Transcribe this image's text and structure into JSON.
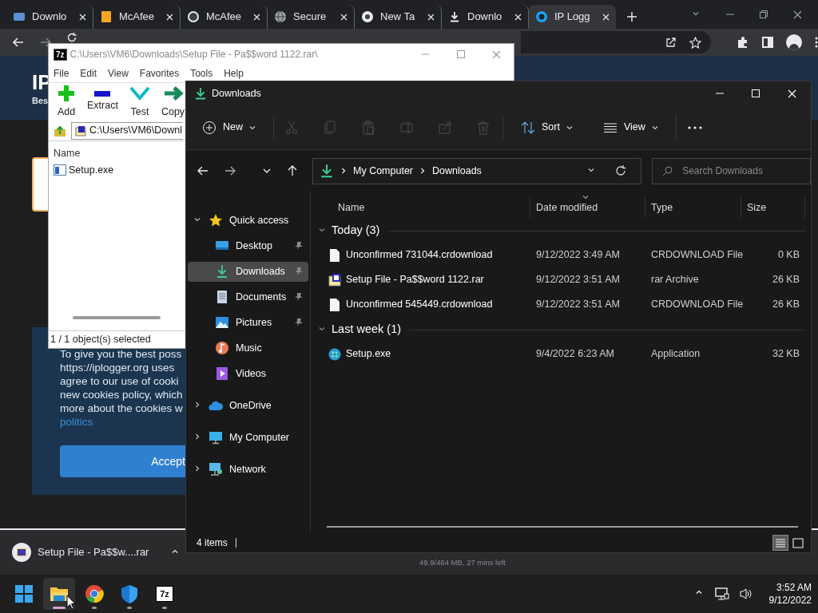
{
  "browser": {
    "tabs": [
      {
        "title": "Downlo",
        "selected": false
      },
      {
        "title": "McAfee",
        "selected": false
      },
      {
        "title": "McAfee",
        "selected": false
      },
      {
        "title": "Secure",
        "selected": false
      },
      {
        "title": "New Ta",
        "selected": false
      },
      {
        "title": "Downlo",
        "selected": false
      },
      {
        "title": "IP Logg",
        "selected": true
      }
    ],
    "page": {
      "header_title": "IP",
      "header_subtitle": "Bes",
      "cookie_lines": [
        "To give you the best poss",
        "https://iplogger.org uses",
        "agree to our use of cooki",
        "new cookies policy, which",
        "more about the cookies w"
      ],
      "cookie_link": "politics",
      "accept_button": "Accept"
    },
    "download_shelf": {
      "items": [
        {
          "name": "Setup File - Pa$$w....rar"
        }
      ],
      "hidden_progress": "49.9/464 MB, 27 mins left"
    }
  },
  "sevenzip": {
    "logo": "7z",
    "title": "C:\\Users\\VM6\\Downloads\\Setup File - Pa$$word 1122.rar\\",
    "menu": [
      "File",
      "Edit",
      "View",
      "Favorites",
      "Tools",
      "Help"
    ],
    "toolbar": [
      "Add",
      "Extract",
      "Test",
      "Copy"
    ],
    "path": "C:\\Users\\VM6\\Downl",
    "column": "Name",
    "files": [
      "Setup.exe"
    ],
    "status": "1 / 1 object(s) selected"
  },
  "explorer": {
    "title": "Downloads",
    "commands": [
      "New",
      "Sort",
      "View"
    ],
    "breadcrumb": [
      "My Computer",
      "Downloads"
    ],
    "search_placeholder": "Search Downloads",
    "nav": [
      {
        "label": "Quick access",
        "expanded": true,
        "selected": false,
        "children": [
          {
            "label": "Desktop",
            "pinned": true,
            "selected": false
          },
          {
            "label": "Downloads",
            "pinned": true,
            "selected": true
          },
          {
            "label": "Documents",
            "pinned": true,
            "selected": false
          },
          {
            "label": "Pictures",
            "pinned": true,
            "selected": false
          },
          {
            "label": "Music",
            "pinned": false,
            "selected": false
          },
          {
            "label": "Videos",
            "pinned": false,
            "selected": false
          }
        ]
      },
      {
        "label": "OneDrive",
        "expanded": false,
        "selected": false
      },
      {
        "label": "My Computer",
        "expanded": false,
        "selected": false
      },
      {
        "label": "Network",
        "expanded": false,
        "selected": false
      }
    ],
    "columns": [
      {
        "label": "Name",
        "sorted": false
      },
      {
        "label": "Date modified",
        "sorted": true
      },
      {
        "label": "Type",
        "sorted": false
      },
      {
        "label": "Size",
        "sorted": false
      }
    ],
    "groups": [
      {
        "label": "Today (3)",
        "expanded": true,
        "files": [
          {
            "kind": "blank",
            "name": "Unconfirmed 731044.crdownload",
            "date": "9/12/2022 3:49 AM",
            "type": "CRDOWNLOAD File",
            "size": "0 KB"
          },
          {
            "kind": "rar",
            "name": "Setup File - Pa$$word 1122.rar",
            "date": "9/12/2022 3:51 AM",
            "type": "rar Archive",
            "size": "26 KB"
          },
          {
            "kind": "blank",
            "name": "Unconfirmed 545449.crdownload",
            "date": "9/12/2022 3:51 AM",
            "type": "CRDOWNLOAD File",
            "size": "26 KB"
          }
        ]
      },
      {
        "label": "Last week (1)",
        "expanded": true,
        "files": [
          {
            "kind": "exe",
            "name": "Setup.exe",
            "date": "9/4/2022 6:23 AM",
            "type": "Application",
            "size": "32 KB"
          }
        ]
      }
    ],
    "status": "4 items",
    "view_modes": [
      {
        "selected": true
      },
      {
        "selected": false
      }
    ]
  },
  "taskbar": {
    "apps": [
      {
        "kind": "start",
        "selected": false
      },
      {
        "kind": "explorer",
        "selected": true
      },
      {
        "kind": "chrome",
        "selected": false
      },
      {
        "kind": "shield",
        "selected": false
      },
      {
        "kind": "sevenzip",
        "selected": false,
        "logo": "7z"
      }
    ],
    "clock": {
      "time": "3:52 AM",
      "date": "9/12/2022"
    }
  }
}
